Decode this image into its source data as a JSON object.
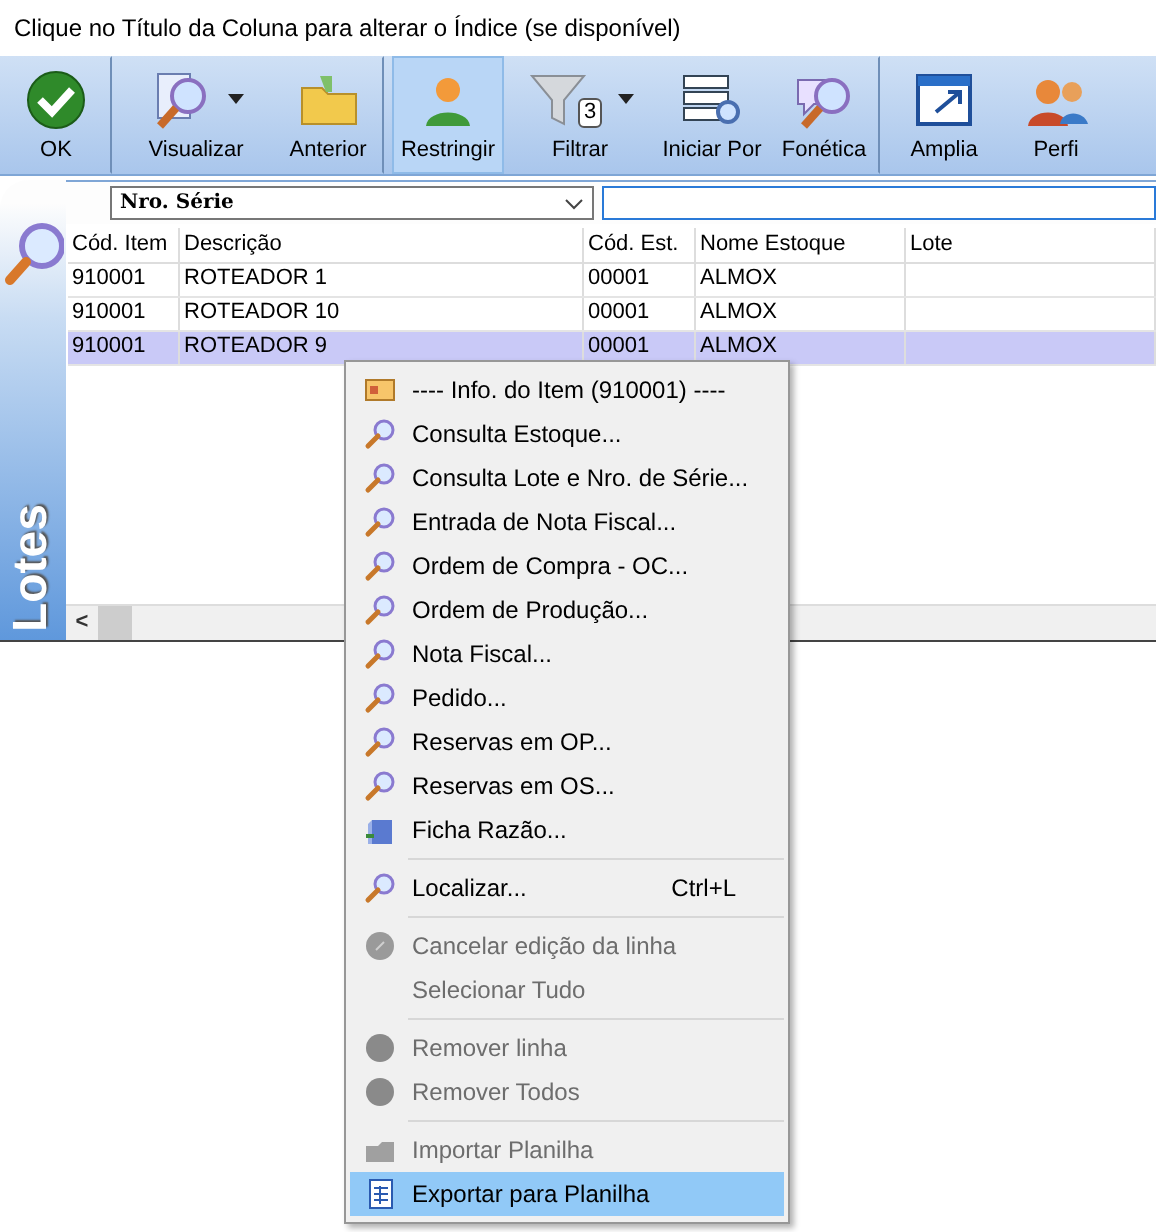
{
  "title": "Clique no Título da Coluna para alterar o Índice (se disponível)",
  "toolbar": [
    {
      "label": "OK",
      "kind": "ok",
      "selected": false,
      "dropdown": false,
      "separator_after": true
    },
    {
      "label": "Visualizar",
      "kind": "view",
      "selected": false,
      "dropdown": true,
      "separator_after": false
    },
    {
      "label": "Anterior",
      "kind": "folder",
      "selected": false,
      "dropdown": false,
      "separator_after": true
    },
    {
      "label": "Restringir",
      "kind": "people",
      "selected": true,
      "dropdown": false,
      "separator_after": false
    },
    {
      "label": "Filtrar",
      "kind": "funnel",
      "selected": false,
      "dropdown": true,
      "badge": "3",
      "separator_after": false
    },
    {
      "label": "Iniciar Por",
      "kind": "names",
      "selected": false,
      "dropdown": false,
      "separator_after": false
    },
    {
      "label": "Fonética",
      "kind": "phonetic",
      "selected": false,
      "dropdown": false,
      "separator_after": true
    },
    {
      "label": "Amplia",
      "kind": "window",
      "selected": false,
      "dropdown": false,
      "separator_after": false
    },
    {
      "label": "Perfi",
      "kind": "users",
      "selected": false,
      "dropdown": false,
      "separator_after": false
    }
  ],
  "panel": {
    "label": "Lotes",
    "index_select": {
      "value": "Nro. Série"
    },
    "columns": [
      "Cód. Item",
      "Descrição",
      "Cód. Est.",
      "Nome Estoque",
      "Lote"
    ],
    "rows": [
      {
        "cells": [
          "910001",
          "ROTEADOR 1",
          "00001",
          "ALMOX",
          ""
        ],
        "selected": false
      },
      {
        "cells": [
          "910001",
          "ROTEADOR 10",
          "00001",
          "ALMOX",
          ""
        ],
        "selected": false
      },
      {
        "cells": [
          "910001",
          "ROTEADOR 9",
          "00001",
          "ALMOX",
          ""
        ],
        "selected": true
      }
    ],
    "scroll_left": "<"
  },
  "context_menu": [
    {
      "kind": "info",
      "label": "---- Info. do Item (910001) ----",
      "disabled": false,
      "selected": false
    },
    {
      "kind": "search",
      "label": "Consulta Estoque...",
      "disabled": false,
      "selected": false
    },
    {
      "kind": "search",
      "label": "Consulta Lote e Nro. de Série...",
      "disabled": false,
      "selected": false
    },
    {
      "kind": "search",
      "label": "Entrada de Nota Fiscal...",
      "disabled": false,
      "selected": false
    },
    {
      "kind": "search",
      "label": "Ordem de Compra - OC...",
      "disabled": false,
      "selected": false
    },
    {
      "kind": "search",
      "label": "Ordem de Produção...",
      "disabled": false,
      "selected": false
    },
    {
      "kind": "search",
      "label": "Nota Fiscal...",
      "disabled": false,
      "selected": false
    },
    {
      "kind": "search",
      "label": "Pedido...",
      "disabled": false,
      "selected": false
    },
    {
      "kind": "search",
      "label": "Reservas em OP...",
      "disabled": false,
      "selected": false
    },
    {
      "kind": "search",
      "label": "Reservas em OS...",
      "disabled": false,
      "selected": false
    },
    {
      "kind": "ledger",
      "label": "Ficha Razão...",
      "disabled": false,
      "selected": false
    },
    {
      "kind": "separator"
    },
    {
      "kind": "search",
      "label": "Localizar...",
      "shortcut": "Ctrl+L",
      "disabled": false,
      "selected": false
    },
    {
      "kind": "separator"
    },
    {
      "kind": "cancel",
      "label": "Cancelar edição da linha",
      "disabled": true,
      "selected": false
    },
    {
      "kind": "plain",
      "label": "Selecionar Tudo",
      "disabled": true,
      "selected": false
    },
    {
      "kind": "separator"
    },
    {
      "kind": "remove",
      "label": "Remover linha",
      "disabled": true,
      "selected": false
    },
    {
      "kind": "remove",
      "label": "Remover Todos",
      "disabled": true,
      "selected": false
    },
    {
      "kind": "separator"
    },
    {
      "kind": "import",
      "label": "Importar Planilha",
      "disabled": true,
      "selected": false
    },
    {
      "kind": "export",
      "label": "Exportar para Planilha",
      "disabled": false,
      "selected": true
    }
  ]
}
